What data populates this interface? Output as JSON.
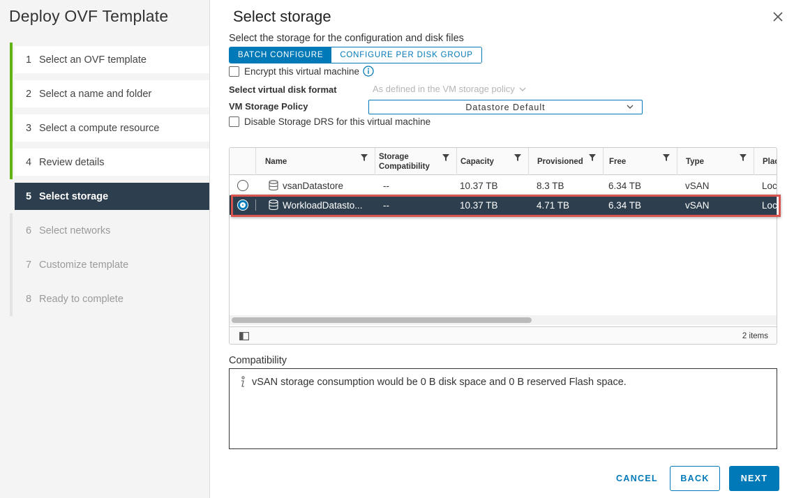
{
  "wizard": {
    "title": "Deploy OVF Template",
    "steps": [
      {
        "num": "1",
        "label": "Select an OVF template"
      },
      {
        "num": "2",
        "label": "Select a name and folder"
      },
      {
        "num": "3",
        "label": "Select a compute resource"
      },
      {
        "num": "4",
        "label": "Review details"
      },
      {
        "num": "5",
        "label": "Select storage"
      },
      {
        "num": "6",
        "label": "Select networks"
      },
      {
        "num": "7",
        "label": "Customize template"
      },
      {
        "num": "8",
        "label": "Ready to complete"
      }
    ]
  },
  "page": {
    "title": "Select storage",
    "subtitle": "Select the storage for the configuration and disk files",
    "close_icon": "close-icon"
  },
  "config_mode": {
    "batch": "BATCH CONFIGURE",
    "per_disk": "CONFIGURE PER DISK GROUP",
    "selected": "BATCH CONFIGURE"
  },
  "encrypt": {
    "label": "Encrypt this virtual machine",
    "checked": false,
    "icon": "info-icon"
  },
  "disk_format": {
    "label": "Select virtual disk format",
    "value": "As defined in the VM storage policy"
  },
  "storage_policy": {
    "label": "VM Storage Policy",
    "value": "Datastore Default"
  },
  "disable_drs": {
    "label": "Disable Storage DRS for this virtual machine",
    "checked": false
  },
  "grid": {
    "columns": [
      "Name",
      "Storage Compatibility",
      "Capacity",
      "Provisioned",
      "Free",
      "Type",
      "Plac"
    ],
    "compat_line1": "Storage",
    "compat_line2": "Compatibility",
    "rows": [
      {
        "name": "vsanDatastore",
        "compat": "--",
        "capacity": "10.37 TB",
        "provisioned": "8.3 TB",
        "free": "6.34 TB",
        "type": "vSAN",
        "place": "Loc",
        "selected": false
      },
      {
        "name": "WorkloadDatasto...",
        "compat": "--",
        "capacity": "10.37 TB",
        "provisioned": "4.71 TB",
        "free": "6.34 TB",
        "type": "vSAN",
        "place": "Loc",
        "selected": true
      }
    ],
    "item_count": "2 items"
  },
  "compatibility": {
    "label": "Compatibility",
    "message": "vSAN storage consumption would be 0 B disk space and 0 B reserved Flash space."
  },
  "footer": {
    "cancel": "CANCEL",
    "back": "BACK",
    "next": "NEXT"
  },
  "colors": {
    "accent": "#0079b8",
    "active_step": "#2d3f4e",
    "done_step": "#60b515",
    "highlight": "#d9534f"
  }
}
